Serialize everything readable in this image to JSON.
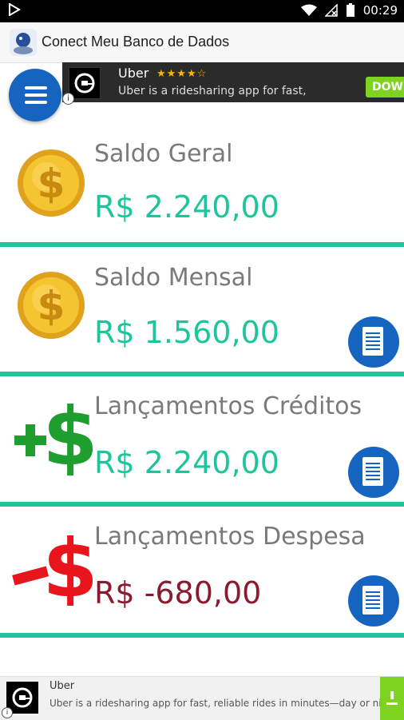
{
  "status_bar": {
    "time": "00:29"
  },
  "app": {
    "title": "Conect Meu Banco de Dados"
  },
  "ad_top": {
    "brand": "Uber",
    "rating_stars": "★★★★☆",
    "text": "Uber is a ridesharing app for fast,",
    "cta": "DOWN",
    "info_label": "i"
  },
  "cards": [
    {
      "title": "Saldo Geral",
      "value": "R$ 2.240,00",
      "value_color": "#1ec59a",
      "icon": "coin-icon",
      "has_details_button": false
    },
    {
      "title": "Saldo Mensal",
      "value": "R$ 1.560,00",
      "value_color": "#1ec59a",
      "icon": "coin-icon",
      "has_details_button": true
    },
    {
      "title": "Lançamentos Créditos",
      "value": "R$ 2.240,00",
      "value_color": "#1ec59a",
      "icon": "plus-dollar-icon",
      "has_details_button": true
    },
    {
      "title": "Lançamentos Despesa",
      "value": "R$ -680,00",
      "value_color": "#8b1a2e",
      "icon": "minus-dollar-icon",
      "has_details_button": true
    }
  ],
  "ad_bottom": {
    "brand": "Uber",
    "text": "Uber is a ridesharing app for fast, reliable rides in minutes—day or nig...",
    "info_label": "i"
  },
  "colors": {
    "accent": "#1ec59a",
    "primary_blue": "#1565c0",
    "negative": "#8b1a2e"
  }
}
